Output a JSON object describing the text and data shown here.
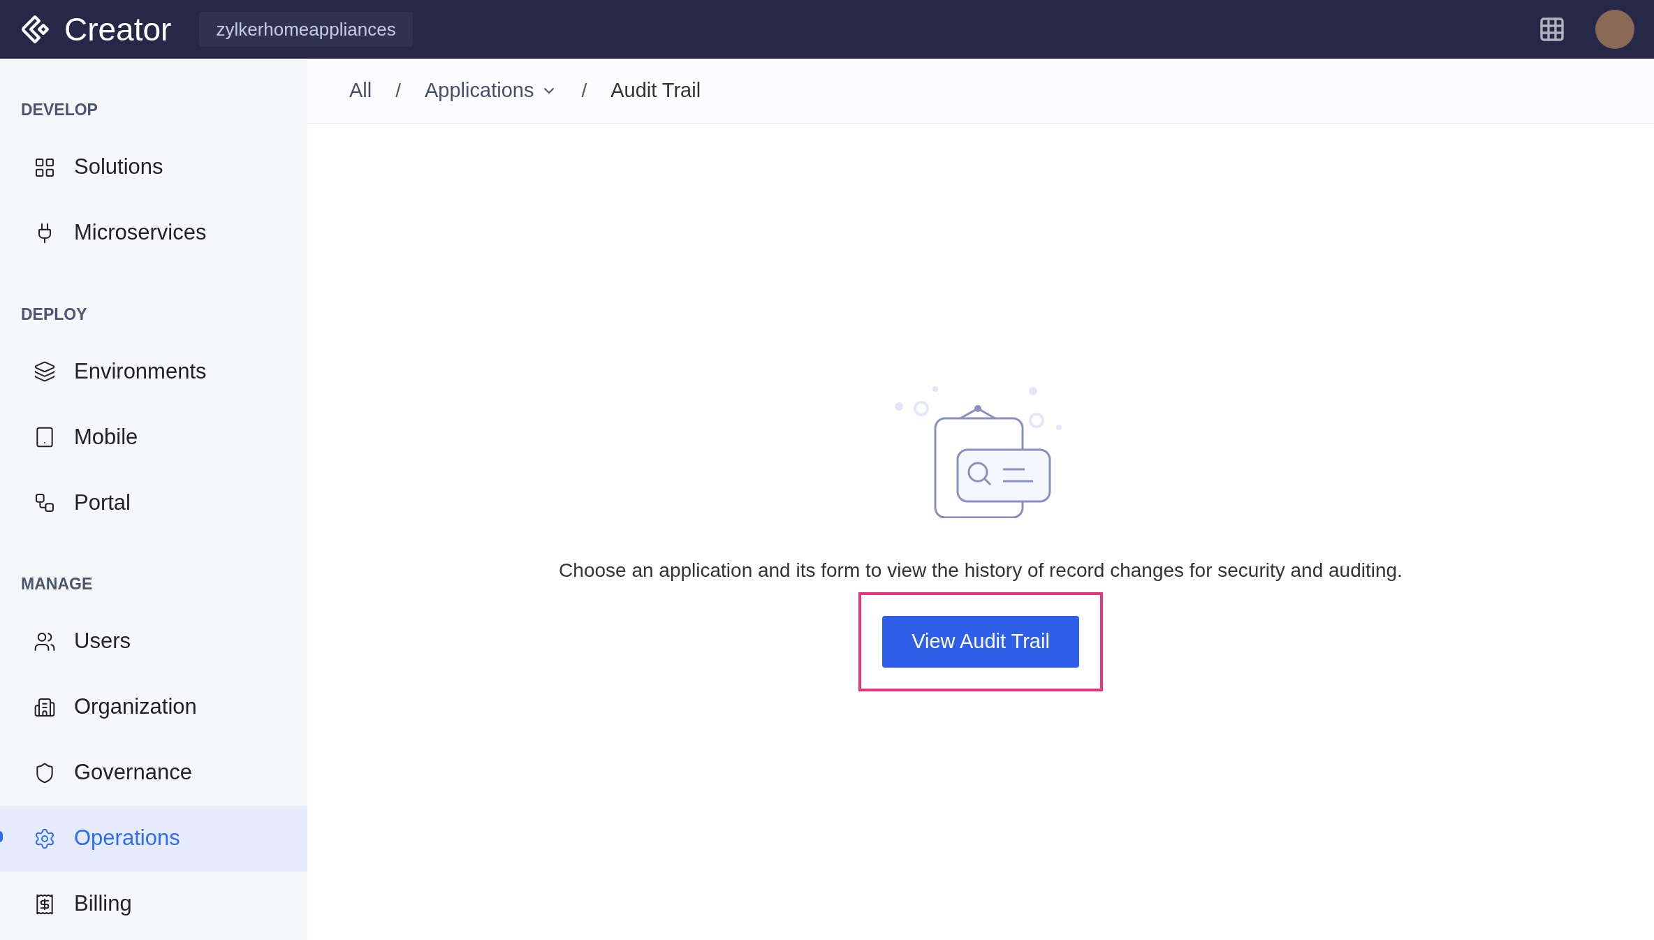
{
  "header": {
    "product": "Creator",
    "workspace": "zylkerhomeappliances"
  },
  "sidebar": {
    "sections": [
      {
        "title": "DEVELOP",
        "items": [
          {
            "label": "Solutions",
            "selected": false
          },
          {
            "label": "Microservices",
            "selected": false
          }
        ]
      },
      {
        "title": "DEPLOY",
        "items": [
          {
            "label": "Environments",
            "selected": false
          },
          {
            "label": "Mobile",
            "selected": false
          },
          {
            "label": "Portal",
            "selected": false
          }
        ]
      },
      {
        "title": "MANAGE",
        "items": [
          {
            "label": "Users",
            "selected": false
          },
          {
            "label": "Organization",
            "selected": false
          },
          {
            "label": "Governance",
            "selected": false
          },
          {
            "label": "Operations",
            "selected": true
          },
          {
            "label": "Billing",
            "selected": false
          }
        ]
      }
    ]
  },
  "breadcrumb": [
    {
      "label": "All",
      "kind": "link"
    },
    {
      "label": "/",
      "kind": "separator"
    },
    {
      "label": "Applications",
      "kind": "dropdown"
    },
    {
      "label": "/",
      "kind": "separator"
    },
    {
      "label": "Audit Trail",
      "kind": "current"
    }
  ],
  "empty_state": {
    "message": "Choose an application and its form to view the history of record changes for security and auditing.",
    "button": "View Audit Trail",
    "highlighted": true
  }
}
